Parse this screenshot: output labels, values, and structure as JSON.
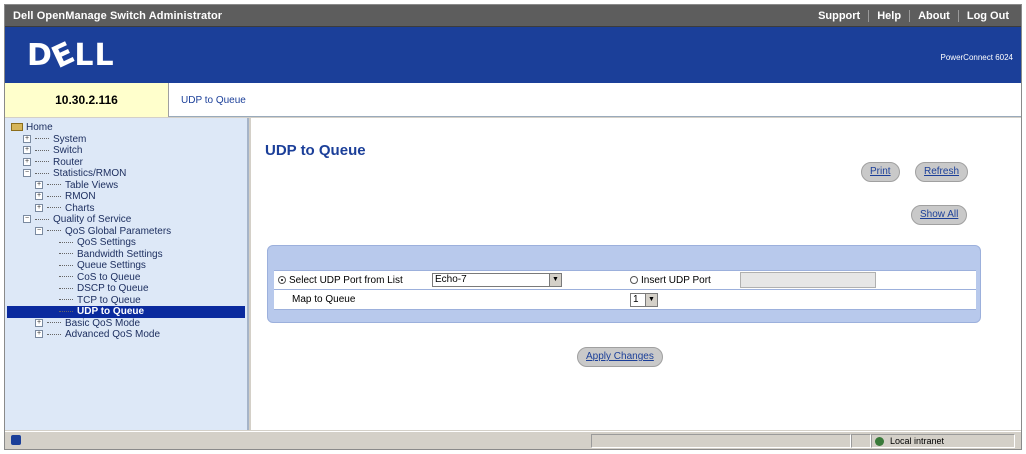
{
  "topbar": {
    "title": "Dell OpenManage Switch Administrator",
    "links": [
      "Support",
      "Help",
      "About",
      "Log Out"
    ]
  },
  "banner": {
    "logo": "DELL",
    "model": "PowerConnect 6024"
  },
  "address": {
    "ip": "10.30.2.116",
    "breadcrumb": "UDP to Queue"
  },
  "sidebar": {
    "items": [
      {
        "label": "Home",
        "level": 0
      },
      {
        "label": "System",
        "level": 1
      },
      {
        "label": "Switch",
        "level": 1
      },
      {
        "label": "Router",
        "level": 1
      },
      {
        "label": "Statistics/RMON",
        "level": 1
      },
      {
        "label": "Table Views",
        "level": 2
      },
      {
        "label": "RMON",
        "level": 2
      },
      {
        "label": "Charts",
        "level": 2
      },
      {
        "label": "Quality of Service",
        "level": 1
      },
      {
        "label": "QoS Global Parameters",
        "level": 2
      },
      {
        "label": "QoS Settings",
        "level": 3
      },
      {
        "label": "Bandwidth Settings",
        "level": 3
      },
      {
        "label": "Queue Settings",
        "level": 3
      },
      {
        "label": "CoS to Queue",
        "level": 3
      },
      {
        "label": "DSCP to Queue",
        "level": 3
      },
      {
        "label": "TCP to Queue",
        "level": 3
      },
      {
        "label": "UDP to Queue",
        "level": 3
      },
      {
        "label": "Basic QoS Mode",
        "level": 2
      },
      {
        "label": "Advanced QoS Mode",
        "level": 2
      }
    ]
  },
  "main": {
    "title": "UDP to Queue",
    "buttons": {
      "print": "Print",
      "refresh": "Refresh",
      "show_all": "Show All",
      "apply": "Apply Changes"
    },
    "form": {
      "select_port_label": "Select UDP Port from List",
      "select_port_value": "Echo-7",
      "insert_port_label": "Insert UDP Port",
      "insert_port_value": "",
      "map_label": "Map to Queue",
      "queue_value": "1"
    }
  },
  "status": {
    "zone": "Local intranet"
  }
}
